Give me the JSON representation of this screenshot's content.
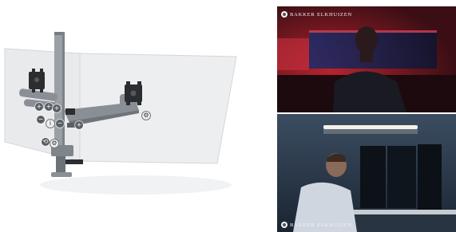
{
  "brand": {
    "name": "BAKKER ELKHUIZEN"
  },
  "viewer_controls": {
    "plus": "+",
    "minus": "−",
    "info": "i"
  },
  "colors": {
    "panel": "#e6e7e9",
    "arm": "#8a8f96",
    "pole": "#9aa0a6",
    "bracket": "#2b2d31",
    "control": "#5a5f66"
  }
}
